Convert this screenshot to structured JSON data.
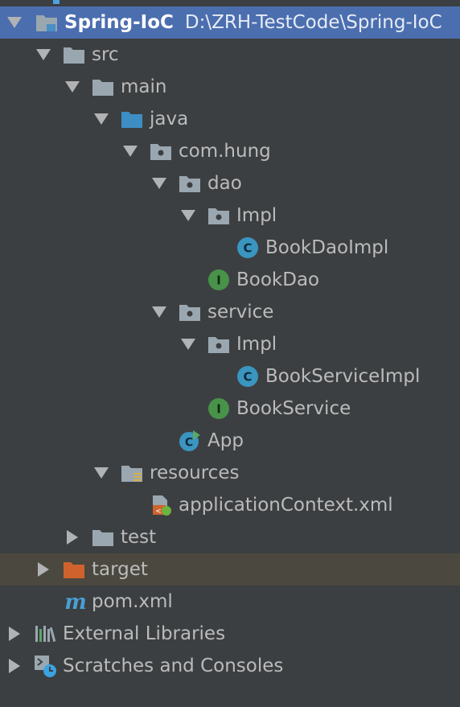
{
  "project": {
    "name": "Spring-IoC",
    "path": "D:\\ZRH-TestCode\\Spring-IoC"
  },
  "nodes": {
    "src": "src",
    "main": "main",
    "java": "java",
    "package": "com.hung",
    "dao": "dao",
    "dao_impl": "Impl",
    "book_dao_impl": "BookDaoImpl",
    "book_dao": "BookDao",
    "service": "service",
    "service_impl": "Impl",
    "book_service_impl": "BookServiceImpl",
    "book_service": "BookService",
    "app": "App",
    "resources": "resources",
    "app_context": "applicationContext.xml",
    "test": "test",
    "target": "target",
    "pom": "pom.xml",
    "external_libraries": "External Libraries",
    "scratches": "Scratches and Consoles"
  },
  "colors": {
    "background": "#3c3f41",
    "selection": "#4b6eaf",
    "excluded": "#4b483f",
    "folder": "#9aa7b0",
    "source_folder": "#3d8ec4",
    "target_folder": "#d0632d",
    "class_icon": "#3a95c0",
    "interface_icon": "#48924a"
  }
}
